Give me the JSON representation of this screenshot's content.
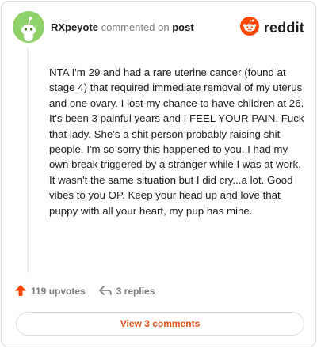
{
  "header": {
    "author": "RXpeyote",
    "action_text": "commented on",
    "post_link": "post",
    "brand": "reddit",
    "avatar_icon": "snoo-avatar-icon"
  },
  "comment": {
    "body": "NTA I'm 29 and had a rare uterine cancer (found at stage 4) that required immediate removal of my uterus and one ovary. I lost my chance to have children at 26. It's been 3 painful years and I FEEL YOUR PAIN. Fuck that lady. She's a shit person probably raising shit people. I'm so sorry this happened to you. I had my own break triggered by a stranger while I was at work. It wasn't the same situation but I did cry...a lot. Good vibes to you OP. Keep your head up and love that puppy with all your heart, my pup has mine."
  },
  "actions": {
    "upvotes": "119 upvotes",
    "replies": "3 replies",
    "view_comments": "View 3 comments"
  },
  "colors": {
    "accent": "#ff4500",
    "link_orange": "#e0531b",
    "avatar_green": "#8fd16a"
  }
}
